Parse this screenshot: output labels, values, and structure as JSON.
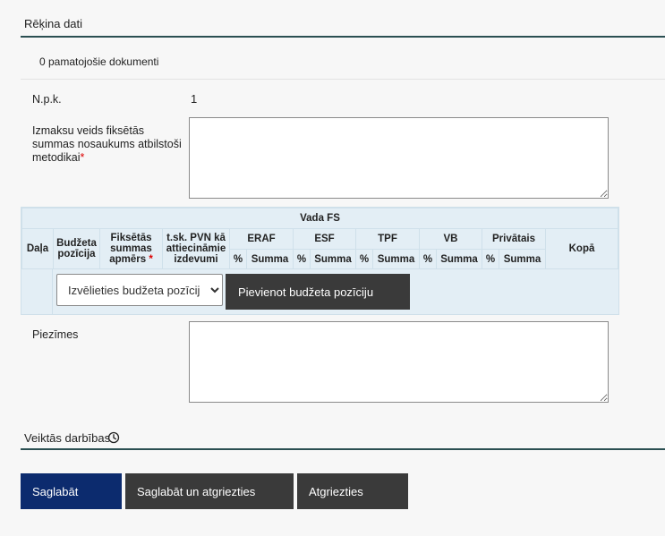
{
  "section": {
    "title": "Rēķina dati",
    "documents": "0 pamatojošie dokumenti"
  },
  "form": {
    "npk_label": "N.p.k.",
    "npk_value": "1",
    "cost_label": "Izmaksu veids fiksētās summas nosaukums atbilstoši metodikai",
    "cost_label_l1": "Izmaksu veids fiksētās",
    "cost_label_l2": "summas nosaukums atbilstoši",
    "cost_label_l3": "metodikai",
    "required_mark": "*",
    "notes_label": "Piezīmes"
  },
  "budget_table": {
    "group_header": "Vada FS",
    "headers": {
      "daja": "Daļa",
      "budget_pos_l1": "Budžeta",
      "budget_pos_l2": "pozīcija",
      "fixed_sum_l1": "Fiksētās",
      "fixed_sum_l2": "summas",
      "fixed_sum_l3": "apmērs",
      "vat_l1": "t.sk. PVN kā",
      "vat_l2": "attiecināmie",
      "vat_l3": "izdevumi",
      "kopa": "Kopā"
    },
    "funds": [
      "ERAF",
      "ESF",
      "TPF",
      "VB",
      "Privātais"
    ],
    "sub_percent": "%",
    "sub_sum": "Summa",
    "select_value": "Izvēlieties budžeta pozīciju",
    "add_button": "Pievienot budžeta pozīciju"
  },
  "actions": {
    "title": "Veiktās darbības",
    "icon": "clock-icon",
    "save": "Saglabāt",
    "save_back": "Saglabāt un atgriezties",
    "back": "Atgriezties"
  },
  "colors": {
    "primary": "#0c2b6e",
    "secondary_button": "#3a3a3a",
    "section_rule": "#2b4f52",
    "table_bg": "#e3eef5",
    "required": "#dd0000"
  }
}
